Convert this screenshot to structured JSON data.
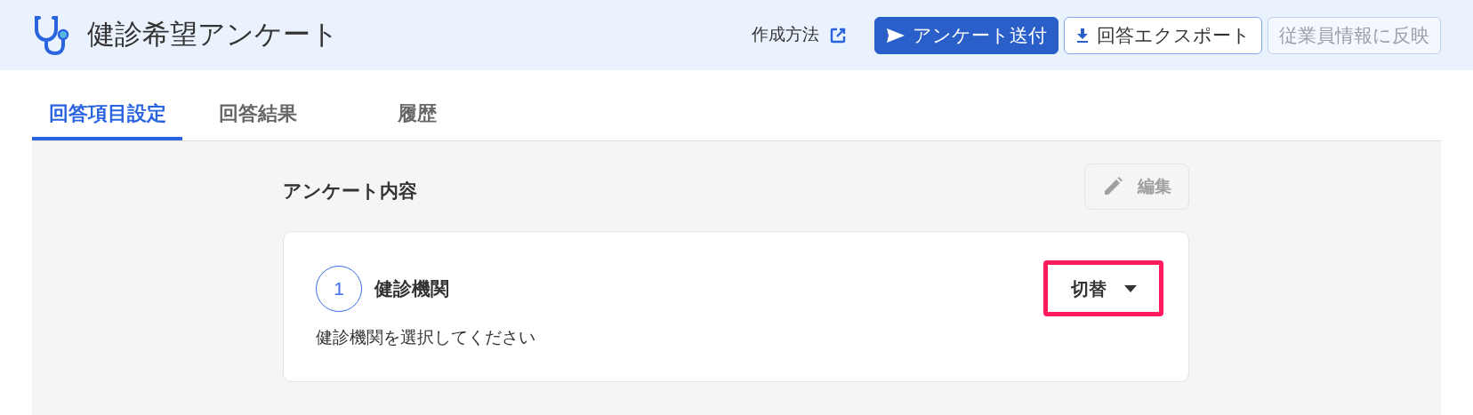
{
  "header": {
    "title": "健診希望アンケート",
    "help_link": "作成方法",
    "buttons": [
      {
        "label": "アンケート送付",
        "kind": "primary",
        "disabled": false
      },
      {
        "label": "回答エクスポート",
        "kind": "outline",
        "disabled": false
      },
      {
        "label": "従業員情報に反映",
        "kind": "outline",
        "disabled": true
      }
    ]
  },
  "tabs": [
    {
      "label": "回答項目設定",
      "selected": true
    },
    {
      "label": "回答結果",
      "selected": false
    },
    {
      "label": "履歴",
      "selected": false
    }
  ],
  "section": {
    "title": "アンケート内容",
    "edit_button": {
      "label": "編集",
      "disabled": true
    },
    "questions": [
      {
        "number": "1",
        "title": "健診機関",
        "type_button": "切替",
        "highlighted": true,
        "description": "健診機関を選択してください"
      }
    ]
  }
}
